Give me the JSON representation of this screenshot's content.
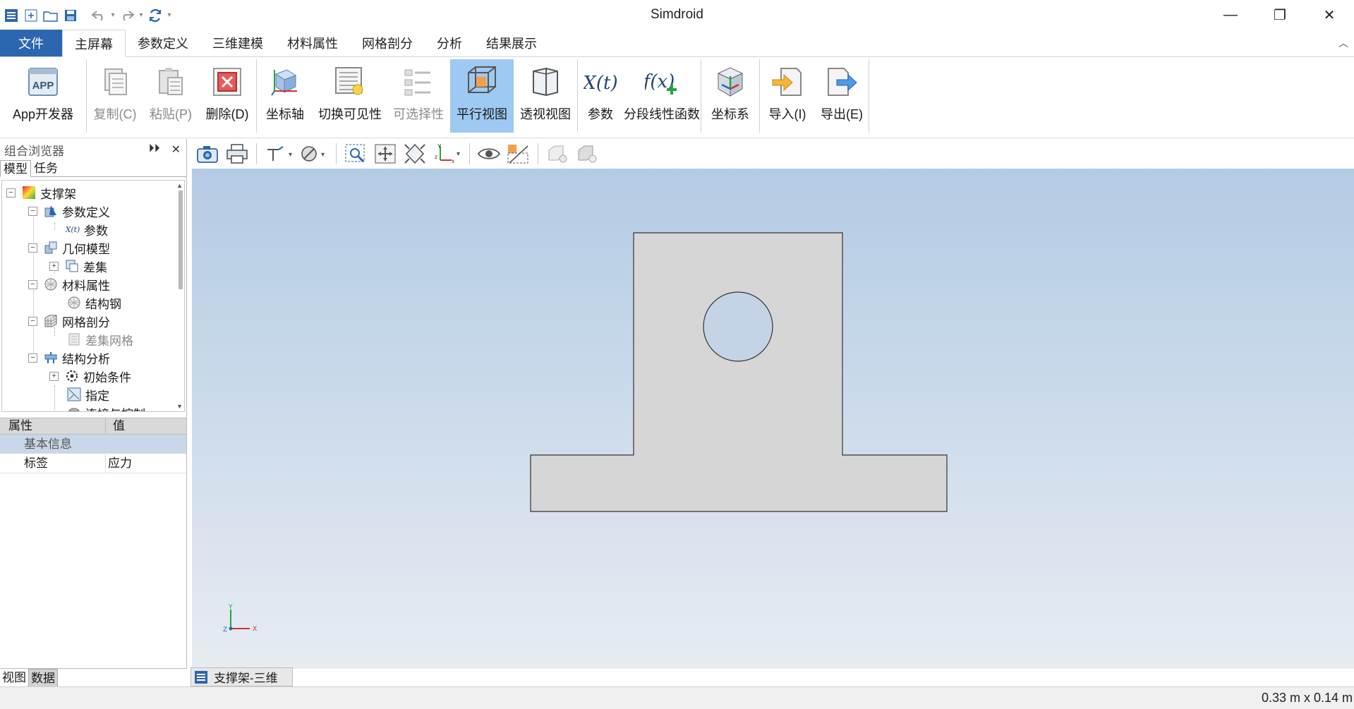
{
  "app": {
    "title": "Simdroid"
  },
  "menu": {
    "file": "文件",
    "tabs": [
      "主屏幕",
      "参数定义",
      "三维建模",
      "材料属性",
      "网格剖分",
      "分析",
      "结果展示"
    ]
  },
  "ribbon": {
    "app_dev": "App开发器",
    "copy": "复制(C)",
    "paste": "粘贴(P)",
    "delete": "删除(D)",
    "axis": "坐标轴",
    "toggle_vis": "切换可见性",
    "selectable": "可选择性",
    "parallel": "平行视图",
    "perspective": "透视视图",
    "params": "参数",
    "piecewise": "分段线性函数",
    "coordsys": "坐标系",
    "import": "导入(I)",
    "export": "导出(E)"
  },
  "browser": {
    "title": "组合浏览器",
    "tab_model": "模型",
    "tab_task": "任务",
    "tree": {
      "root": "支撑架",
      "param_def": "参数定义",
      "param": "参数",
      "geometry": "几何模型",
      "diff": "差集",
      "material": "材料属性",
      "steel": "结构钢",
      "mesh": "网格剖分",
      "diff_mesh": "差集网格",
      "struct": "结构分析",
      "init": "初始条件",
      "assign": "指定",
      "cut": "连接与控制"
    }
  },
  "props": {
    "col_prop": "属性",
    "col_val": "值",
    "section": "基本信息",
    "row_label": "标签",
    "row_value": "应力"
  },
  "bottom_tabs": {
    "view": "视图",
    "data": "数据"
  },
  "doc_tab": "支撑架-三维",
  "status": {
    "dims": "0.33 m x 0.14 m"
  },
  "colors": {
    "file_tab": "#2b66b0",
    "selected": "#9ec9f2",
    "part_fill": "#d6d6d6"
  }
}
